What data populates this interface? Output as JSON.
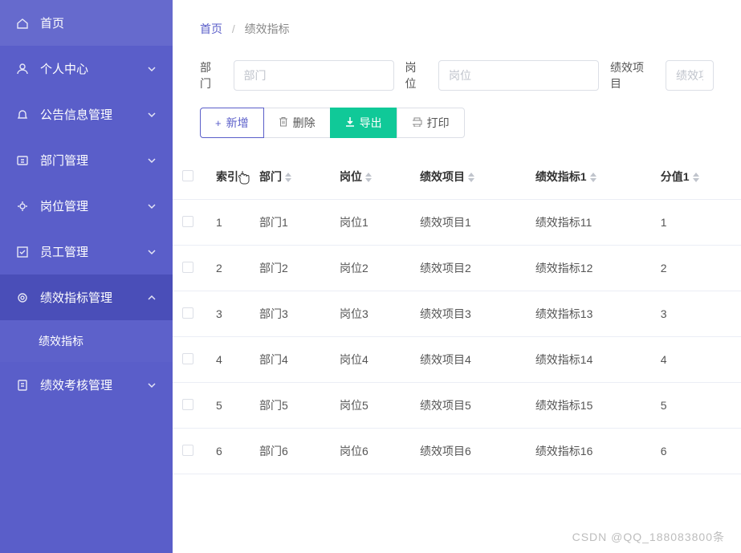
{
  "sidebar": {
    "items": [
      {
        "label": "首页",
        "icon": "home"
      },
      {
        "label": "个人中心",
        "icon": "user",
        "expandable": true
      },
      {
        "label": "公告信息管理",
        "icon": "bell",
        "expandable": true
      },
      {
        "label": "部门管理",
        "icon": "dept",
        "expandable": true
      },
      {
        "label": "岗位管理",
        "icon": "position",
        "expandable": true
      },
      {
        "label": "员工管理",
        "icon": "employee",
        "expandable": true
      },
      {
        "label": "绩效指标管理",
        "icon": "target",
        "expandable": true,
        "expanded": true,
        "children": [
          {
            "label": "绩效指标",
            "selected": true
          }
        ]
      },
      {
        "label": "绩效考核管理",
        "icon": "assess",
        "expandable": true
      }
    ]
  },
  "breadcrumb": {
    "home": "首页",
    "current": "绩效指标"
  },
  "filters": {
    "dept": {
      "label": "部门",
      "placeholder": "部门"
    },
    "position": {
      "label": "岗位",
      "placeholder": "岗位"
    },
    "project": {
      "label": "绩效项目",
      "placeholder": "绩效项目"
    }
  },
  "toolbar": {
    "add": "新增",
    "delete": "删除",
    "export": "导出",
    "print": "打印"
  },
  "table": {
    "columns": [
      "索引",
      "部门",
      "岗位",
      "绩效项目",
      "绩效指标1",
      "分值1"
    ],
    "rows": [
      {
        "idx": "1",
        "dept": "部门1",
        "pos": "岗位1",
        "proj": "绩效项目1",
        "ind": "绩效指标11",
        "score": "1"
      },
      {
        "idx": "2",
        "dept": "部门2",
        "pos": "岗位2",
        "proj": "绩效项目2",
        "ind": "绩效指标12",
        "score": "2"
      },
      {
        "idx": "3",
        "dept": "部门3",
        "pos": "岗位3",
        "proj": "绩效项目3",
        "ind": "绩效指标13",
        "score": "3"
      },
      {
        "idx": "4",
        "dept": "部门4",
        "pos": "岗位4",
        "proj": "绩效项目4",
        "ind": "绩效指标14",
        "score": "4"
      },
      {
        "idx": "5",
        "dept": "部门5",
        "pos": "岗位5",
        "proj": "绩效项目5",
        "ind": "绩效指标15",
        "score": "5"
      },
      {
        "idx": "6",
        "dept": "部门6",
        "pos": "岗位6",
        "proj": "绩效项目6",
        "ind": "绩效指标16",
        "score": "6"
      }
    ]
  },
  "watermark": "CSDN @QQ_188083800条"
}
